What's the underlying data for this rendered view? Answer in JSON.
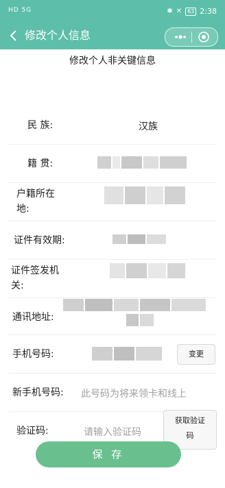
{
  "status_bar": {
    "left_icons": "HD 5G",
    "time": "2:38",
    "battery": "63"
  },
  "nav": {
    "title": "修改个人信息",
    "back_icon": "chevron-left-icon",
    "more_icon": "more-dots-icon",
    "target_icon": "target-icon"
  },
  "page": {
    "title": "修改个人非关键信息"
  },
  "form": {
    "ethnicity_label": "民 族:",
    "ethnicity_value": "汉族",
    "native_place_label": "籍 贯:",
    "household_label_line1": "户籍所在",
    "household_label_line2": "地:",
    "validity_label": "证件有效期:",
    "issuer_label_line1": "证件签发机",
    "issuer_label_line2": "关:",
    "address_label": "通讯地址:",
    "phone_label": "手机号码:",
    "change_button": "变更",
    "new_phone_label": "新手机号码:",
    "new_phone_placeholder": "此号码为将来领卡和线上",
    "code_label": "验证码:",
    "code_placeholder": "请输入验证码",
    "get_code_line1": "获取验证",
    "get_code_line2": "码"
  },
  "save_button": "保 存",
  "colors": {
    "nav_bg": "#5dbfa9",
    "save_bg": "#69c08e"
  }
}
